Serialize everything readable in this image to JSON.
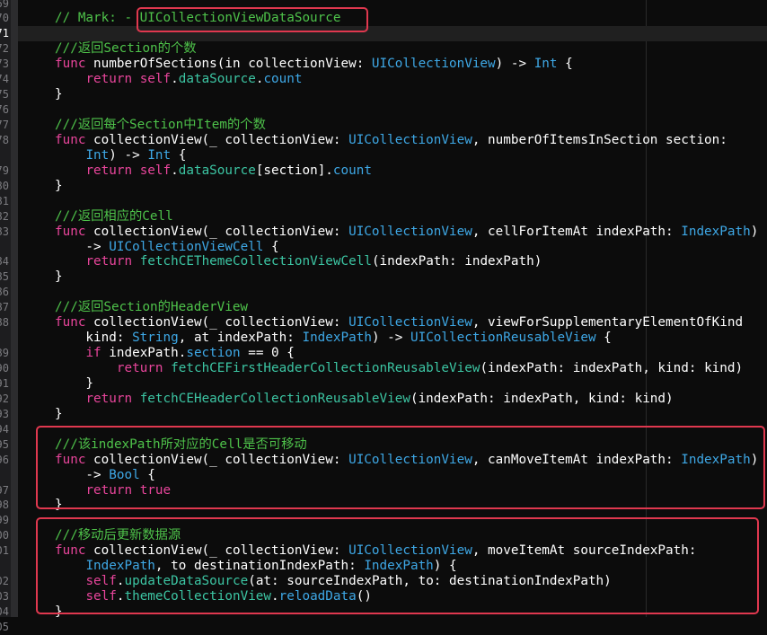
{
  "editor": {
    "current_line": 71,
    "colors": {
      "comment": "#4ec24a",
      "keyword": "#e8459b",
      "type": "#3ea8e6",
      "project_symbol": "#3cc5a3",
      "highlight_box": "#e0384f"
    },
    "lines": [
      {
        "n": "69",
        "tokens": []
      },
      {
        "n": "70",
        "tokens": [
          [
            "c",
            "// Mark: - UICollectionViewDataSource"
          ]
        ]
      },
      {
        "n": "71",
        "tokens": []
      },
      {
        "n": "72",
        "tokens": [
          [
            "c",
            "///返回Section的个数"
          ]
        ]
      },
      {
        "n": "73",
        "tokens": [
          [
            "k",
            "func"
          ],
          [
            "p",
            " numberOfSections(in collectionView: "
          ],
          [
            "t",
            "UICollectionView"
          ],
          [
            "p",
            ") -> "
          ],
          [
            "t",
            "Int"
          ],
          [
            "p",
            " {"
          ]
        ]
      },
      {
        "n": "74",
        "tokens": [
          [
            "p",
            "    "
          ],
          [
            "k",
            "return"
          ],
          [
            "p",
            " "
          ],
          [
            "k",
            "self"
          ],
          [
            "p",
            "."
          ],
          [
            "m",
            "dataSource"
          ],
          [
            "p",
            "."
          ],
          [
            "sys",
            "count"
          ]
        ]
      },
      {
        "n": "75",
        "tokens": [
          [
            "p",
            "}"
          ]
        ]
      },
      {
        "n": "76",
        "tokens": []
      },
      {
        "n": "77",
        "tokens": [
          [
            "c",
            "///返回每个Section中Item的个数"
          ]
        ]
      },
      {
        "n": "78",
        "tokens": [
          [
            "k",
            "func"
          ],
          [
            "p",
            " collectionView(_ collectionView: "
          ],
          [
            "t",
            "UICollectionView"
          ],
          [
            "p",
            ", numberOfItemsInSection section:"
          ]
        ]
      },
      {
        "n": "",
        "tokens": [
          [
            "p",
            "    "
          ],
          [
            "t",
            "Int"
          ],
          [
            "p",
            ") -> "
          ],
          [
            "t",
            "Int"
          ],
          [
            "p",
            " {"
          ]
        ]
      },
      {
        "n": "79",
        "tokens": [
          [
            "p",
            "    "
          ],
          [
            "k",
            "return"
          ],
          [
            "p",
            " "
          ],
          [
            "k",
            "self"
          ],
          [
            "p",
            "."
          ],
          [
            "m",
            "dataSource"
          ],
          [
            "p",
            "[section]."
          ],
          [
            "sys",
            "count"
          ]
        ]
      },
      {
        "n": "80",
        "tokens": [
          [
            "p",
            "}"
          ]
        ]
      },
      {
        "n": "81",
        "tokens": []
      },
      {
        "n": "82",
        "tokens": [
          [
            "c",
            "///返回相应的Cell"
          ]
        ]
      },
      {
        "n": "83",
        "tokens": [
          [
            "k",
            "func"
          ],
          [
            "p",
            " collectionView(_ collectionView: "
          ],
          [
            "t",
            "UICollectionView"
          ],
          [
            "p",
            ", cellForItemAt indexPath: "
          ],
          [
            "t",
            "IndexPath"
          ],
          [
            "p",
            ")"
          ]
        ]
      },
      {
        "n": "",
        "tokens": [
          [
            "p",
            "    -> "
          ],
          [
            "t",
            "UICollectionViewCell"
          ],
          [
            "p",
            " {"
          ]
        ]
      },
      {
        "n": "84",
        "tokens": [
          [
            "p",
            "    "
          ],
          [
            "k",
            "return"
          ],
          [
            "p",
            " "
          ],
          [
            "m",
            "fetchCEThemeCollectionViewCell"
          ],
          [
            "p",
            "(indexPath: indexPath)"
          ]
        ]
      },
      {
        "n": "85",
        "tokens": [
          [
            "p",
            "}"
          ]
        ]
      },
      {
        "n": "86",
        "tokens": []
      },
      {
        "n": "87",
        "tokens": [
          [
            "c",
            "///返回Section的HeaderView"
          ]
        ]
      },
      {
        "n": "88",
        "tokens": [
          [
            "k",
            "func"
          ],
          [
            "p",
            " collectionView(_ collectionView: "
          ],
          [
            "t",
            "UICollectionView"
          ],
          [
            "p",
            ", viewForSupplementaryElementOfKind"
          ]
        ]
      },
      {
        "n": "",
        "tokens": [
          [
            "p",
            "    kind: "
          ],
          [
            "t",
            "String"
          ],
          [
            "p",
            ", at indexPath: "
          ],
          [
            "t",
            "IndexPath"
          ],
          [
            "p",
            ") -> "
          ],
          [
            "t",
            "UICollectionReusableView"
          ],
          [
            "p",
            " {"
          ]
        ]
      },
      {
        "n": "89",
        "tokens": [
          [
            "p",
            "    "
          ],
          [
            "k",
            "if"
          ],
          [
            "p",
            " indexPath."
          ],
          [
            "sys",
            "section"
          ],
          [
            "p",
            " == "
          ],
          [
            "n",
            "0"
          ],
          [
            "p",
            " {"
          ]
        ]
      },
      {
        "n": "90",
        "tokens": [
          [
            "p",
            "        "
          ],
          [
            "k",
            "return"
          ],
          [
            "p",
            " "
          ],
          [
            "m",
            "fetchCEFirstHeaderCollectionReusableView"
          ],
          [
            "p",
            "(indexPath: indexPath, kind: kind)"
          ]
        ]
      },
      {
        "n": "91",
        "tokens": [
          [
            "p",
            "    }"
          ]
        ]
      },
      {
        "n": "92",
        "tokens": [
          [
            "p",
            "    "
          ],
          [
            "k",
            "return"
          ],
          [
            "p",
            " "
          ],
          [
            "m",
            "fetchCEHeaderCollectionReusableView"
          ],
          [
            "p",
            "(indexPath: indexPath, kind: kind)"
          ]
        ]
      },
      {
        "n": "93",
        "tokens": [
          [
            "p",
            "}"
          ]
        ]
      },
      {
        "n": "94",
        "tokens": []
      },
      {
        "n": "95",
        "tokens": [
          [
            "c",
            "///该indexPath所对应的Cell是否可移动"
          ]
        ]
      },
      {
        "n": "96",
        "tokens": [
          [
            "k",
            "func"
          ],
          [
            "p",
            " collectionView(_ collectionView: "
          ],
          [
            "t",
            "UICollectionView"
          ],
          [
            "p",
            ", canMoveItemAt indexPath: "
          ],
          [
            "t",
            "IndexPath"
          ],
          [
            "p",
            ")"
          ]
        ]
      },
      {
        "n": "",
        "tokens": [
          [
            "p",
            "    -> "
          ],
          [
            "t",
            "Bool"
          ],
          [
            "p",
            " {"
          ]
        ]
      },
      {
        "n": "97",
        "tokens": [
          [
            "p",
            "    "
          ],
          [
            "k",
            "return"
          ],
          [
            "p",
            " "
          ],
          [
            "k",
            "true"
          ]
        ]
      },
      {
        "n": "98",
        "tokens": [
          [
            "p",
            "}"
          ]
        ]
      },
      {
        "n": "99",
        "tokens": []
      },
      {
        "n": "100",
        "tokens": [
          [
            "c",
            "///移动后更新数据源"
          ]
        ]
      },
      {
        "n": "101",
        "tokens": [
          [
            "k",
            "func"
          ],
          [
            "p",
            " collectionView(_ collectionView: "
          ],
          [
            "t",
            "UICollectionView"
          ],
          [
            "p",
            ", moveItemAt sourceIndexPath:"
          ]
        ]
      },
      {
        "n": "",
        "tokens": [
          [
            "p",
            "    "
          ],
          [
            "t",
            "IndexPath"
          ],
          [
            "p",
            ", to destinationIndexPath: "
          ],
          [
            "t",
            "IndexPath"
          ],
          [
            "p",
            ") {"
          ]
        ]
      },
      {
        "n": "102",
        "tokens": [
          [
            "p",
            "    "
          ],
          [
            "k",
            "self"
          ],
          [
            "p",
            "."
          ],
          [
            "m",
            "updateDataSource"
          ],
          [
            "p",
            "(at: sourceIndexPath, to: destinationIndexPath)"
          ]
        ]
      },
      {
        "n": "103",
        "tokens": [
          [
            "p",
            "    "
          ],
          [
            "k",
            "self"
          ],
          [
            "p",
            "."
          ],
          [
            "m",
            "themeCollectionView"
          ],
          [
            "p",
            "."
          ],
          [
            "sys",
            "reloadData"
          ],
          [
            "p",
            "()"
          ]
        ]
      },
      {
        "n": "104",
        "tokens": [
          [
            "p",
            "}"
          ]
        ]
      },
      {
        "n": "105",
        "tokens": []
      }
    ]
  }
}
